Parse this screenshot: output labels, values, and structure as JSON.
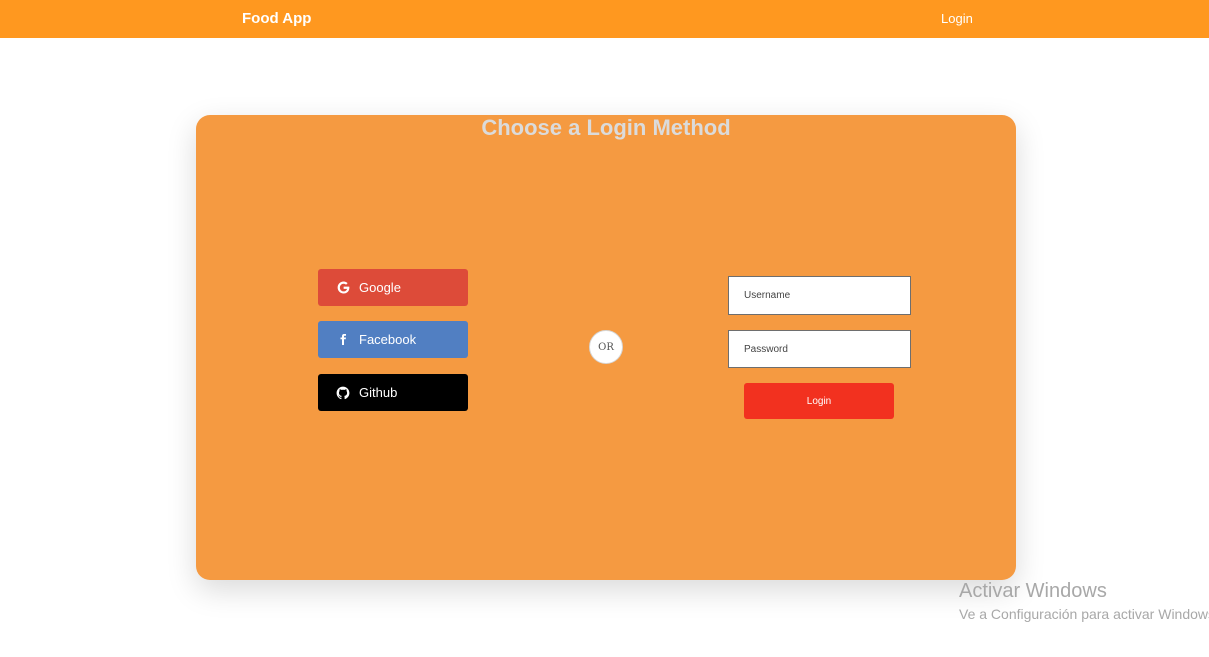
{
  "navbar": {
    "brand": "Food App",
    "login_link": "Login"
  },
  "card": {
    "title": "Choose a Login Method",
    "social_buttons": [
      {
        "label": "Google",
        "icon": "google-icon",
        "color": "#dd4b39"
      },
      {
        "label": "Facebook",
        "icon": "facebook-icon",
        "color": "#517fc2"
      },
      {
        "label": "Github",
        "icon": "github-icon",
        "color": "#000000"
      }
    ],
    "divider": "OR",
    "form": {
      "username_placeholder": "Username",
      "username_value": "",
      "password_placeholder": "Password",
      "password_value": "",
      "submit_label": "Login"
    }
  },
  "watermark": {
    "title": "Activar Windows",
    "subtitle": "Ve a Configuración para activar Windows."
  },
  "colors": {
    "navbar": "#ff981f",
    "card": "#f59a41",
    "submit": "#f2311f"
  }
}
